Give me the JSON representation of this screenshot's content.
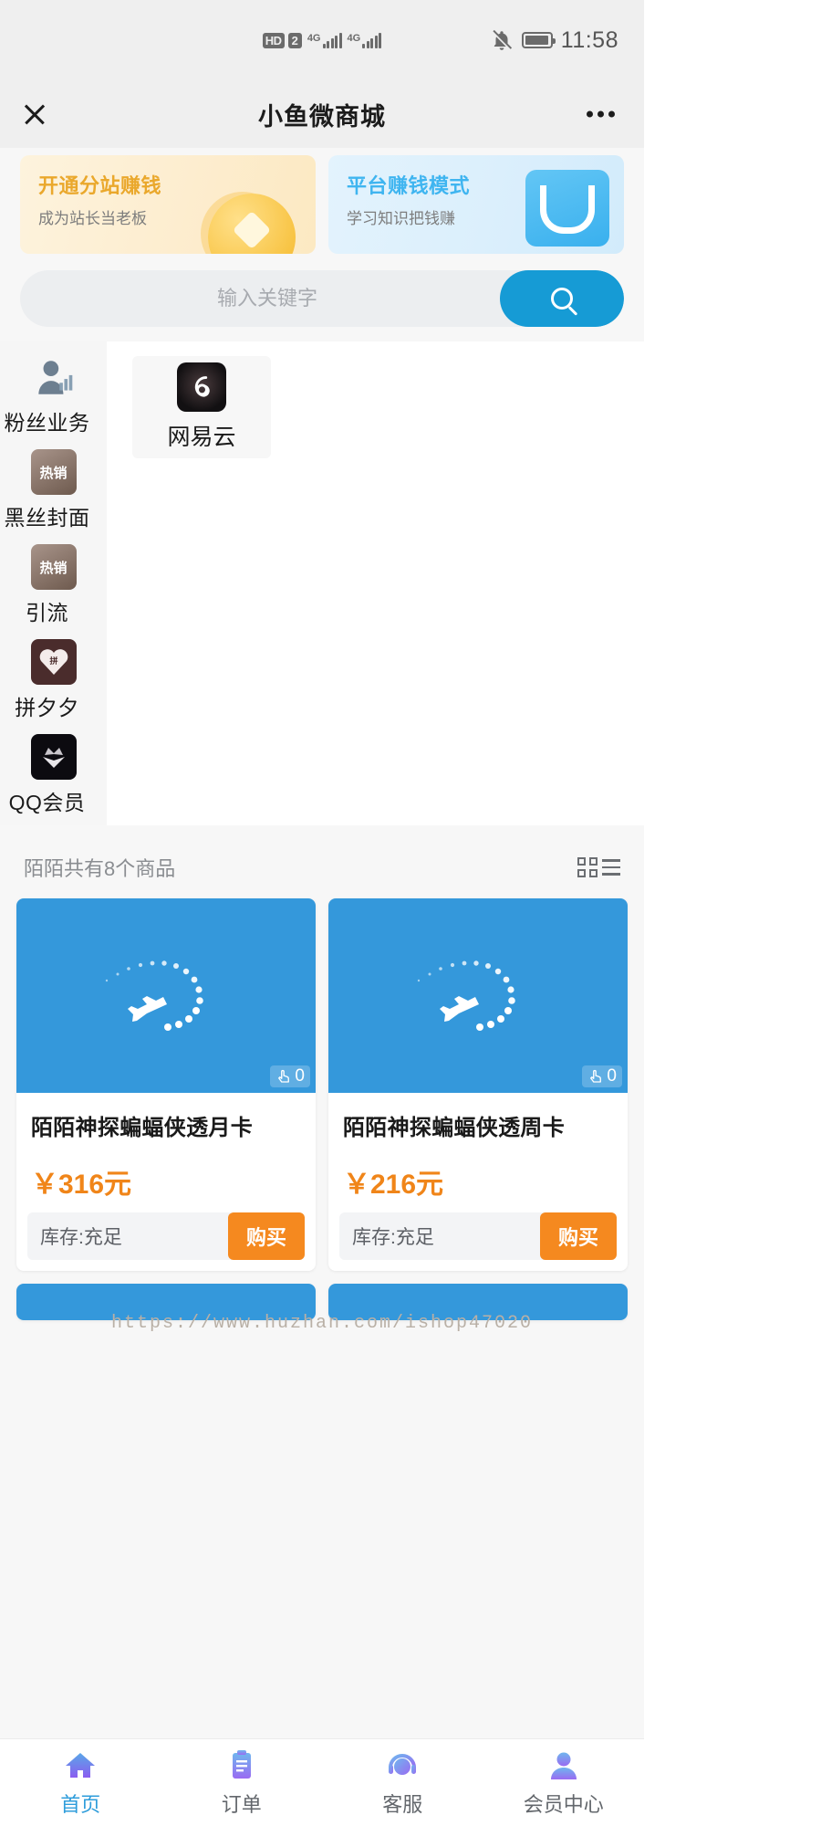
{
  "status_bar": {
    "hd_badge": "HD",
    "sim_badge": "2",
    "network_1": "4G",
    "network_2": "4G",
    "time": "11:58",
    "mute_icon": "bell-muted-icon",
    "battery_icon": "battery-icon"
  },
  "header": {
    "title": "小鱼微商城",
    "close_icon": "close-icon",
    "more_icon": "more-options-icon"
  },
  "banners": [
    {
      "title": "开通分站赚钱",
      "subtitle": "成为站长当老板",
      "title_color": "#eaa82c",
      "bg_color": "#fdf1d8",
      "icon": "gold-coin-icon"
    },
    {
      "title": "平台赚钱模式",
      "subtitle": "学习知识把钱赚",
      "title_color": "#3fb5f0",
      "bg_color": "#dceffc",
      "icon": "shopping-bag-icon"
    }
  ],
  "search": {
    "placeholder": "输入关键字",
    "value": "",
    "button_icon": "search-icon",
    "button_color": "#169bd5"
  },
  "categories": {
    "items": [
      {
        "label": "粉丝业务",
        "icon": "fans-business-icon",
        "active": true
      },
      {
        "label": "黑丝封面",
        "icon": "hot-sale-icon",
        "badge": "热销",
        "active": false
      },
      {
        "label": "引流",
        "icon": "hot-sale-icon",
        "badge": "热销",
        "active": false
      },
      {
        "label": "拼夕夕",
        "icon": "pinduoduo-icon",
        "active": false
      },
      {
        "label": "QQ会员",
        "icon": "qq-vip-icon",
        "active": false
      }
    ],
    "apps": [
      {
        "name": "网易云",
        "icon": "netease-music-icon"
      }
    ]
  },
  "products_section": {
    "summary": "陌陌共有8个商品",
    "view_toggle_icon": "grid-list-toggle-icon",
    "items": [
      {
        "title": "陌陌神探蝙蝠侠透月卡",
        "price": "￥316元",
        "stock": "库存:充足",
        "buy_label": "购买",
        "views": "0",
        "views_icon": "touch-hand-icon",
        "image_color": "#3498db",
        "image_icon": "airplane-trail-icon"
      },
      {
        "title": "陌陌神探蝙蝠侠透周卡",
        "price": "￥216元",
        "stock": "库存:充足",
        "buy_label": "购买",
        "views": "0",
        "views_icon": "touch-hand-icon",
        "image_color": "#3498db",
        "image_icon": "airplane-trail-icon"
      }
    ]
  },
  "watermark": "https://www.huzhan.com/ishop47020",
  "tabbar": {
    "items": [
      {
        "label": "首页",
        "icon": "home-icon",
        "active": true
      },
      {
        "label": "订单",
        "icon": "order-list-icon",
        "active": false
      },
      {
        "label": "客服",
        "icon": "customer-service-icon",
        "active": false
      },
      {
        "label": "会员中心",
        "icon": "member-center-icon",
        "active": false
      }
    ],
    "active_color": "#2f9ddb"
  }
}
